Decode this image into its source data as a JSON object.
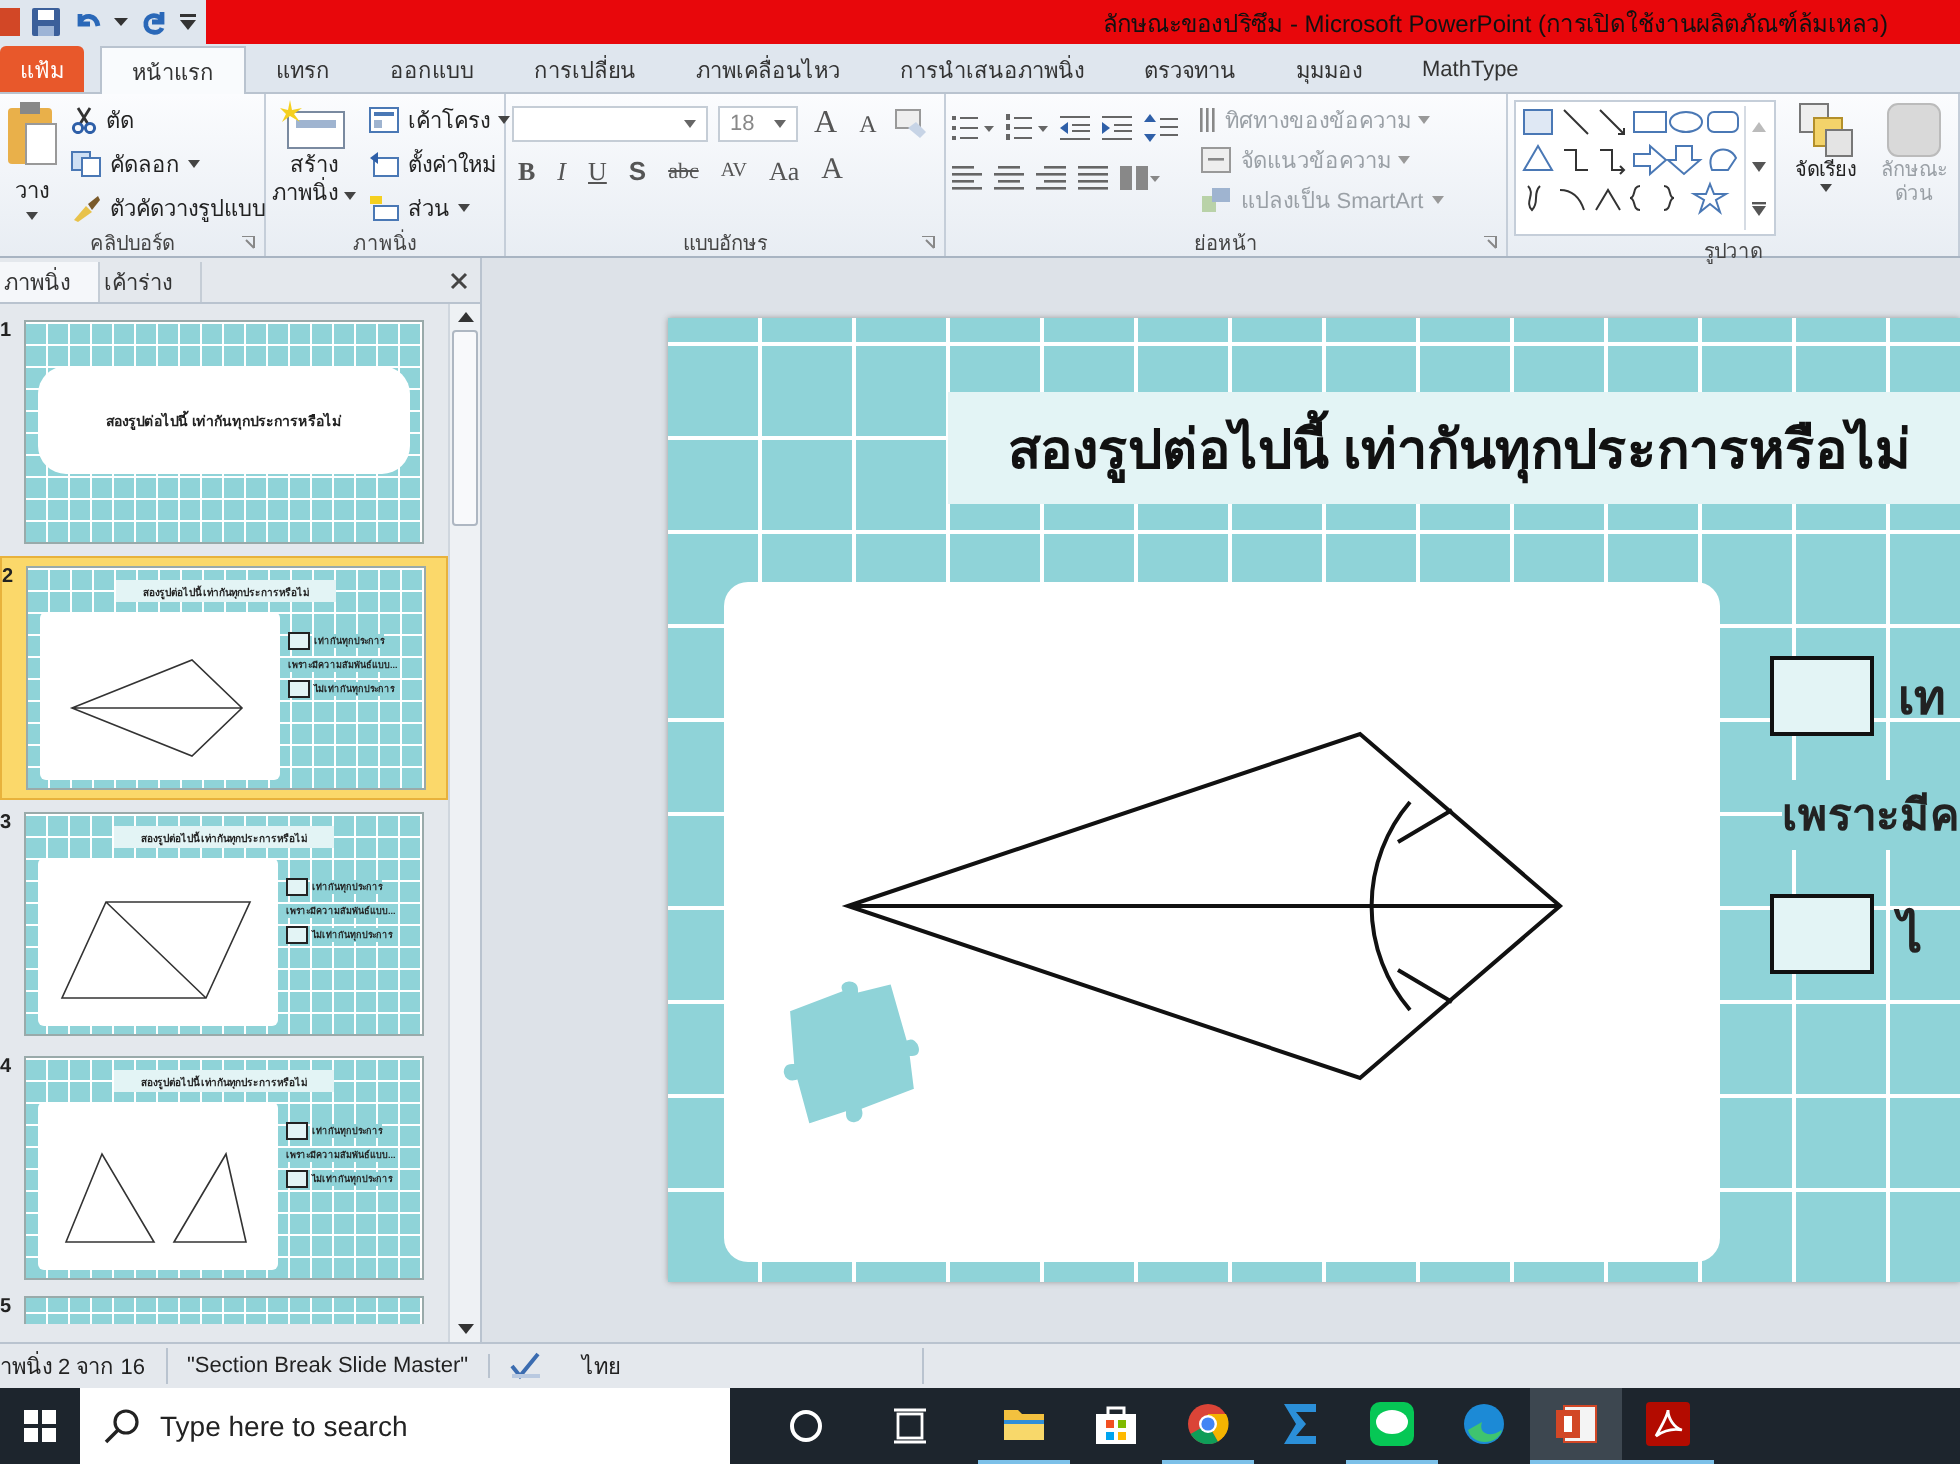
{
  "window": {
    "title": "ลักษณะของปริซึม - Microsoft PowerPoint (การเปิดใช้งานผลิตภัณฑ์ล้มเหลว)"
  },
  "ribbon_tabs": [
    {
      "label": "แฟ้ม",
      "kind": "file",
      "selected": false
    },
    {
      "label": "หน้าแรก",
      "kind": "tab",
      "selected": true
    },
    {
      "label": "แทรก",
      "kind": "tab",
      "selected": false
    },
    {
      "label": "ออกแบบ",
      "kind": "tab",
      "selected": false
    },
    {
      "label": "การเปลี่ยน",
      "kind": "tab",
      "selected": false
    },
    {
      "label": "ภาพเคลื่อนไหว",
      "kind": "tab",
      "selected": false
    },
    {
      "label": "การนำเสนอภาพนิ่ง",
      "kind": "tab",
      "selected": false
    },
    {
      "label": "ตรวจทาน",
      "kind": "tab",
      "selected": false
    },
    {
      "label": "มุมมอง",
      "kind": "tab",
      "selected": false
    },
    {
      "label": "MathType",
      "kind": "tab",
      "selected": false
    }
  ],
  "clipboard": {
    "label": "คลิปบอร์ด",
    "paste": "วาง",
    "items": [
      {
        "label": "ตัด",
        "kind": "cut",
        "dropdown": false
      },
      {
        "label": "คัดลอก",
        "kind": "copy",
        "dropdown": true
      },
      {
        "label": "ตัวคัดวางรูปแบบ",
        "kind": "painter",
        "dropdown": false
      }
    ]
  },
  "slides_group": {
    "label": "ภาพนิ่ง",
    "new_slide": [
      "สร้าง",
      "ภาพนิ่ง"
    ],
    "items": [
      {
        "label": "เค้าโครง",
        "kind": "layout",
        "dropdown": true
      },
      {
        "label": "ตั้งค่าใหม่",
        "kind": "reset",
        "dropdown": false
      },
      {
        "label": "ส่วน",
        "kind": "section",
        "dropdown": true
      }
    ]
  },
  "font": {
    "label": "แบบอักษร",
    "size": "18",
    "grow": "A",
    "shrink": "A",
    "buttons": [
      {
        "text": "B",
        "kind": "bold"
      },
      {
        "text": "I",
        "kind": "italic"
      },
      {
        "text": "U",
        "kind": "underline"
      },
      {
        "text": "S",
        "kind": "shadow"
      },
      {
        "text": "abc",
        "kind": "strike"
      },
      {
        "text": "AV",
        "kind": "spacing"
      },
      {
        "text": "Aa",
        "kind": "case"
      },
      {
        "text": "A",
        "kind": "color"
      }
    ]
  },
  "paragraph": {
    "label": "ย่อหน้า",
    "items": [
      {
        "label": "ทิศทางของข้อความ",
        "kind": "direction",
        "disabled": true
      },
      {
        "label": "จัดแนวข้อความ",
        "kind": "align",
        "disabled": true
      },
      {
        "label": "แปลงเป็น SmartArt",
        "kind": "smartart",
        "disabled": true
      }
    ]
  },
  "drawing": {
    "label": "รูปวาด",
    "arrange": "จัดเรียง",
    "quick_styles": {
      "label": [
        "ลักษณะ",
        "ด่วน"
      ],
      "disabled": true
    }
  },
  "slide_panel": {
    "tabs": [
      {
        "label": "ภาพนิ่ง",
        "selected": true
      },
      {
        "label": "เค้าร่าง",
        "selected": false
      }
    ],
    "slides": [
      {
        "number": "1",
        "kind": "title",
        "selected": false,
        "title": "สองรูปต่อไปนี้ เท่ากันทุกประการหรือไม่"
      },
      {
        "number": "2",
        "kind": "question",
        "selected": true,
        "figure": {
          "kind": "kite"
        },
        "title": "สองรูปต่อไปนี้  เท่ากันทุกประการหรือไม่",
        "options": [
          "เท่ากันทุกประการ",
          "ไม่เท่ากันทุกประการ"
        ],
        "reason": "เพราะมีความสัมพันธ์แบบ..."
      },
      {
        "number": "3",
        "kind": "question",
        "selected": false,
        "figure": {
          "kind": "parallelogram"
        },
        "title": "สองรูปต่อไปนี้  เท่ากันทุกประการหรือไม่",
        "options": [
          "เท่ากันทุกประการ",
          "ไม่เท่ากันทุกประการ"
        ],
        "reason": "เพราะมีความสัมพันธ์แบบ..."
      },
      {
        "number": "4",
        "kind": "question",
        "selected": false,
        "figure": {
          "kind": "triangles"
        },
        "title": "สองรูปต่อไปนี้  เท่ากันทุกประการหรือไม่",
        "options": [
          "เท่ากันทุกประการ",
          "ไม่เท่ากันทุกประการ"
        ],
        "reason": "เพราะมีความสัมพันธ์แบบ..."
      },
      {
        "number": "5",
        "kind": "partial",
        "selected": false
      }
    ]
  },
  "slide": {
    "title": "สองรูปต่อไปนี้ เท่ากันทุกประการหรือไม่",
    "figure": {
      "kind": "kite"
    },
    "options": [
      "เท",
      "ไ"
    ],
    "reason": "เพราะมีค"
  },
  "status_bar": {
    "slide_info": "าพนิ่ง 2 จาก 16",
    "theme": "\"Section Break Slide Master\"",
    "language": "ไทย"
  },
  "taskbar": {
    "search": {
      "placeholder": "Type here to search"
    },
    "apps": [
      {
        "kind": "explorer",
        "running": true,
        "selected": false
      },
      {
        "kind": "store",
        "running": false,
        "selected": false
      },
      {
        "kind": "chrome",
        "running": true,
        "selected": false
      },
      {
        "kind": "sigma",
        "running": false,
        "selected": false
      },
      {
        "kind": "line",
        "running": true,
        "selected": false
      },
      {
        "kind": "edge",
        "running": false,
        "selected": false
      },
      {
        "kind": "powerpoint",
        "running": true,
        "selected": true
      },
      {
        "kind": "acrobat",
        "running": true,
        "selected": false
      }
    ]
  }
}
